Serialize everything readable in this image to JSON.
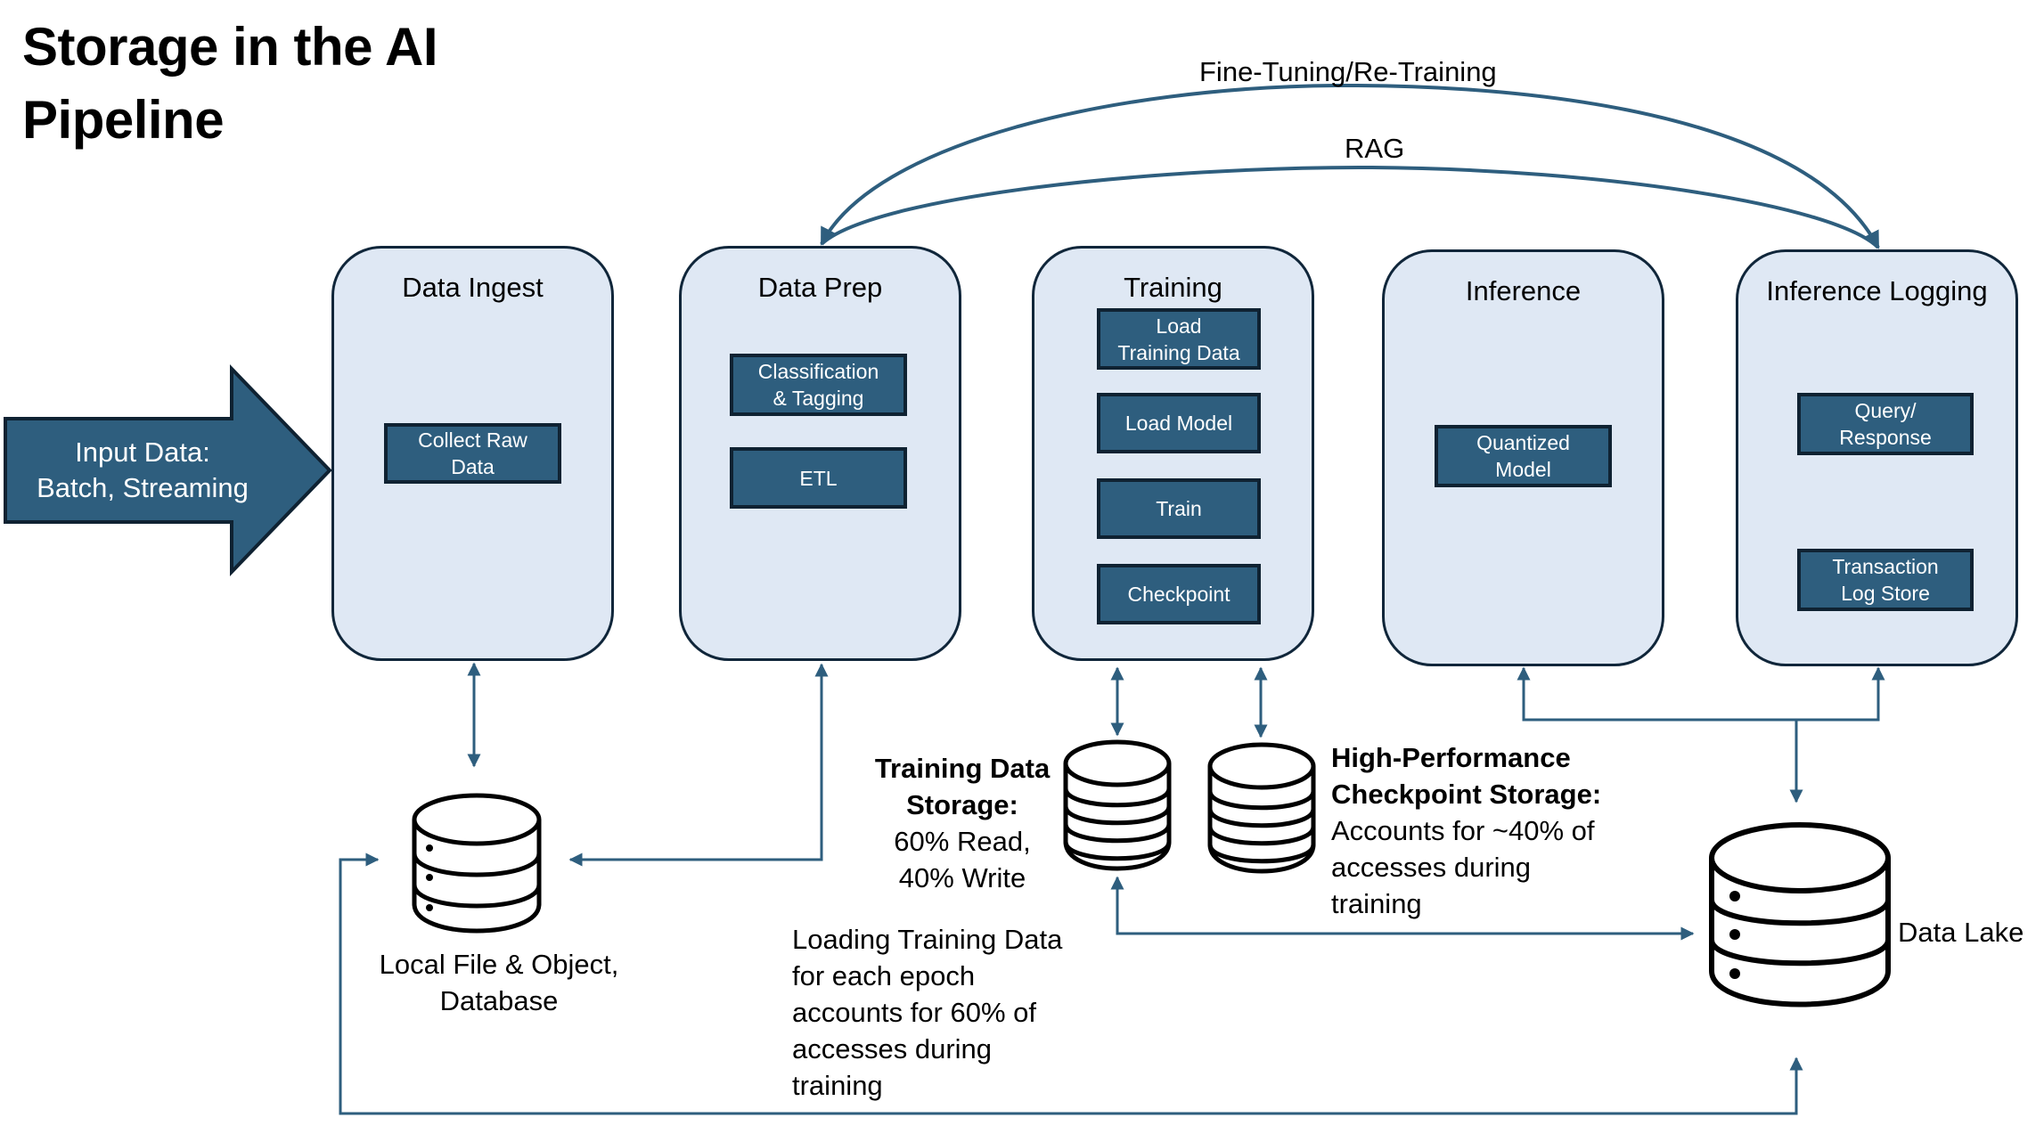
{
  "title": "Storage in the AI Pipeline",
  "colors": {
    "stage_fill": "#dfe8f4",
    "stage_border": "#10263a",
    "process_fill": "#2e5e7e",
    "connector": "#2e5e7e",
    "text": "#000000"
  },
  "input": {
    "label": "Input Data:\nBatch, Streaming"
  },
  "feedback_loops": [
    {
      "label": "Fine-Tuning/Re-Training",
      "from": "Inference Logging",
      "to": "Data Prep"
    },
    {
      "label": "RAG",
      "from": "Inference Logging",
      "to": "Data Prep"
    }
  ],
  "stages": [
    {
      "title": "Data Ingest",
      "steps": [
        "Collect Raw\nData"
      ]
    },
    {
      "title": "Data Prep",
      "steps": [
        "Classification\n& Tagging",
        "ETL"
      ]
    },
    {
      "title": "Training",
      "steps": [
        "Load\nTraining Data",
        "Load Model",
        "Train",
        "Checkpoint"
      ]
    },
    {
      "title": "Inference",
      "steps": [
        "Quantized\nModel"
      ]
    },
    {
      "title": "Inference Logging",
      "steps": [
        "Query/\nResponse",
        "Transaction\nLog Store"
      ]
    }
  ],
  "storage": {
    "local": {
      "label": "Local File & Object,\nDatabase",
      "icon": "database-icon"
    },
    "training_data": {
      "title": "Training Data\nStorage:",
      "detail": "60% Read,\n40% Write",
      "icon": "disk-stack-icon"
    },
    "checkpoint": {
      "title": "High-Performance\nCheckpoint Storage:",
      "detail": "Accounts for ~40% of\naccesses during\ntraining",
      "icon": "disk-stack-icon"
    },
    "data_lake": {
      "label": "Data Lake",
      "icon": "database-icon"
    }
  },
  "notes": {
    "loading_training_data": "Loading Training Data\nfor each epoch\naccounts for 60% of\naccesses during\ntraining"
  }
}
